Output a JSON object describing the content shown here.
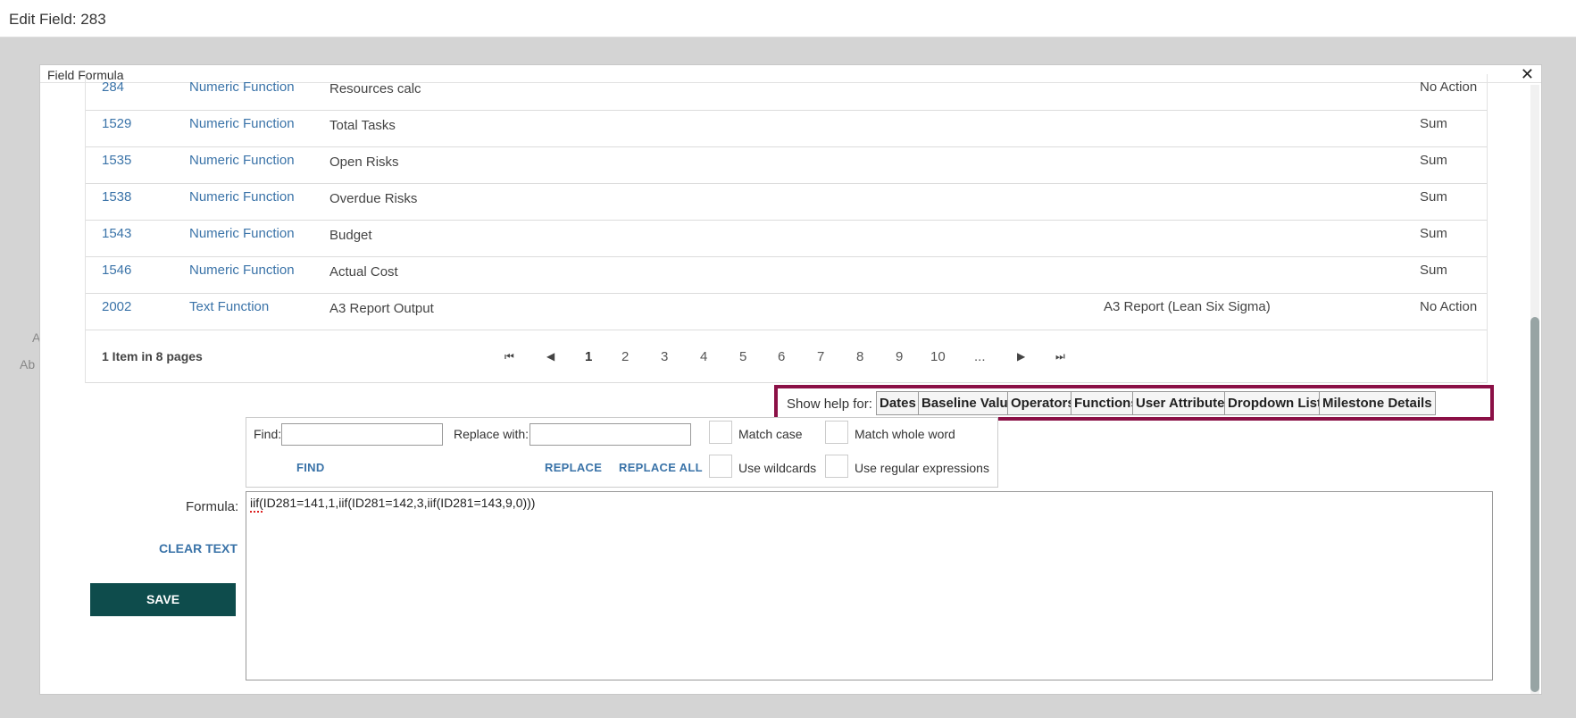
{
  "page": {
    "title": "Edit Field: 283"
  },
  "background": {
    "hint_a": "A",
    "hint_ab": "Ab"
  },
  "modal": {
    "title": "Field Formula",
    "close_glyph": "✕"
  },
  "grid": {
    "rows": [
      {
        "id": "284",
        "type": "Numeric Function",
        "name": "Resources calc",
        "ref": "",
        "agg": "No Action"
      },
      {
        "id": "1529",
        "type": "Numeric Function",
        "name": "Total Tasks",
        "ref": "",
        "agg": "Sum"
      },
      {
        "id": "1535",
        "type": "Numeric Function",
        "name": "Open Risks",
        "ref": "",
        "agg": "Sum"
      },
      {
        "id": "1538",
        "type": "Numeric Function",
        "name": "Overdue Risks",
        "ref": "",
        "agg": "Sum"
      },
      {
        "id": "1543",
        "type": "Numeric Function",
        "name": "Budget",
        "ref": "",
        "agg": "Sum"
      },
      {
        "id": "1546",
        "type": "Numeric Function",
        "name": "Actual Cost",
        "ref": "",
        "agg": "Sum"
      },
      {
        "id": "2002",
        "type": "Text Function",
        "name": "A3 Report Output",
        "ref": "A3 Report (Lean Six Sigma)",
        "agg": "No Action"
      }
    ],
    "pager": {
      "info": "1 Item in 8 pages",
      "first": "⏮",
      "prev": "◀",
      "pages": [
        "1",
        "2",
        "3",
        "4",
        "5",
        "6",
        "7",
        "8",
        "9",
        "10",
        "..."
      ],
      "next": "▶",
      "last": "⏭"
    }
  },
  "help": {
    "label": "Show help for:",
    "buttons": [
      "Dates",
      "Baseline Values",
      "Operators",
      "Functions",
      "User Attributes",
      "Dropdown Lists",
      "Milestone Details"
    ]
  },
  "find": {
    "find_label": "Find:",
    "find_value": "",
    "replace_label": "Replace with:",
    "replace_value": "",
    "find_button": "FIND",
    "replace_button": "REPLACE",
    "replace_all_button": "REPLACE ALL",
    "match_case": "Match case",
    "match_whole_word": "Match whole word",
    "use_wildcards": "Use wildcards",
    "use_regex": "Use regular expressions"
  },
  "formula": {
    "label": "Formula:",
    "value": "iif(ID281=141,1,iif(ID281=142,3,iif(ID281=143,9,0)))",
    "clear_button": "CLEAR TEXT",
    "save_button": "SAVE"
  },
  "colors": {
    "accent": "#3a73a8",
    "save": "#0e4c4c",
    "highlight": "#8b1046"
  }
}
